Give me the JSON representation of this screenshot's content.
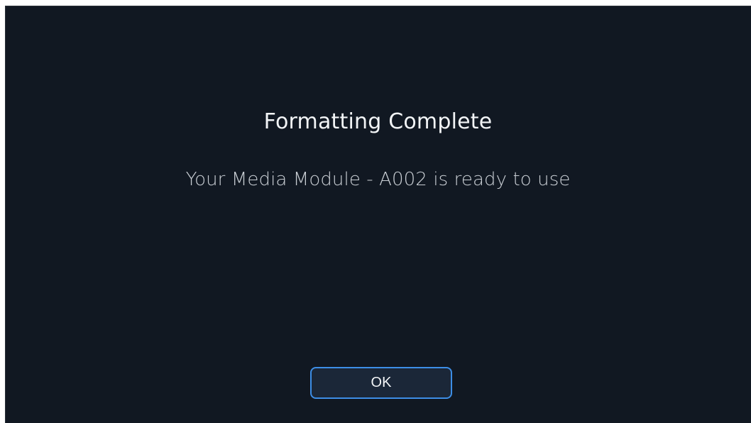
{
  "dialog": {
    "title": "Formatting Complete",
    "message": "Your Media Module - A002 is ready to use",
    "ok_label": "OK"
  },
  "colors": {
    "background": "#111822",
    "accent": "#3d8ee6",
    "button_fill": "#1b2738",
    "text": "#f2f4f6"
  }
}
